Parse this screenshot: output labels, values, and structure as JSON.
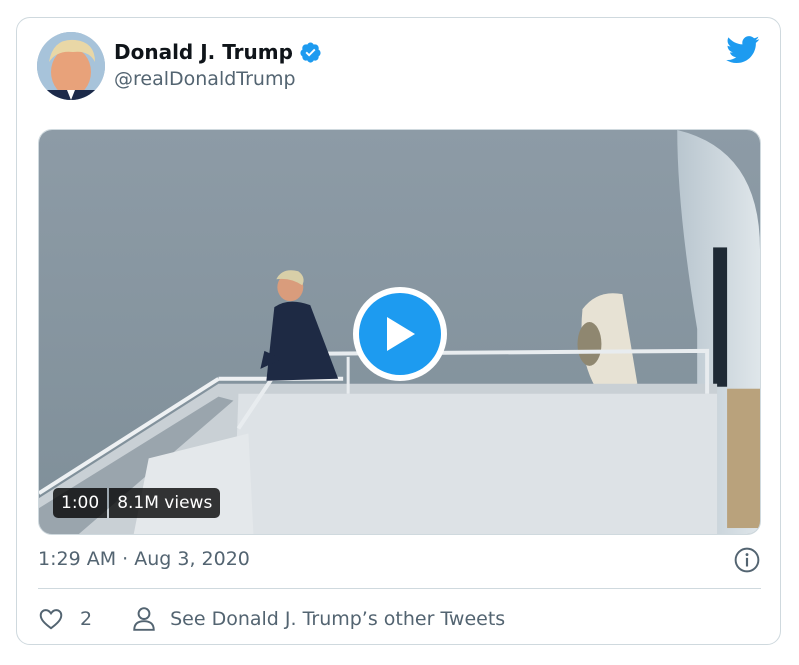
{
  "author": {
    "display_name": "Donald J. Trump",
    "handle": "@realDonaldTrump",
    "verified": true
  },
  "media": {
    "duration": "1:00",
    "views": "8.1M views"
  },
  "timestamp": "1:29 AM · Aug 3, 2020",
  "actions": {
    "like_count": "2",
    "other_tweets_label": "See Donald J. Trump’s other Tweets"
  },
  "colors": {
    "accent": "#1d9bf0",
    "text_secondary": "#536471",
    "border": "#cfd9de"
  },
  "icons": [
    "verified-badge-icon",
    "twitter-bird-icon",
    "play-icon",
    "info-icon",
    "heart-icon",
    "person-icon"
  ]
}
